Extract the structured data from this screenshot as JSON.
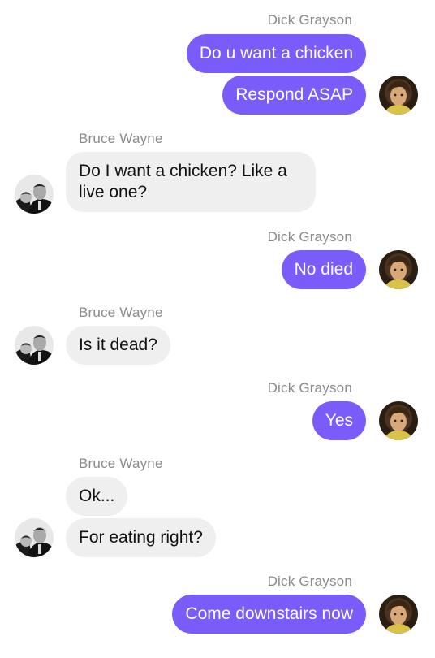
{
  "conversation": {
    "groups": [
      {
        "sender": "Dick Grayson",
        "messages": [
          "Do u want a chicken",
          "Respond ASAP"
        ]
      },
      {
        "sender": "Bruce Wayne",
        "messages": [
          "Do I want a chicken? Like a live one?"
        ]
      },
      {
        "sender": "Dick Grayson",
        "messages": [
          "No died"
        ]
      },
      {
        "sender": "Bruce Wayne",
        "messages": [
          "Is it dead?"
        ]
      },
      {
        "sender": "Dick Grayson",
        "messages": [
          "Yes"
        ]
      },
      {
        "sender": "Bruce Wayne",
        "messages": [
          "Ok...",
          "For eating right?"
        ]
      },
      {
        "sender": "Dick Grayson",
        "messages": [
          "Come downstairs now"
        ]
      }
    ]
  },
  "colors": {
    "outgoing_bubble": "#7a5cfa",
    "incoming_bubble": "#efeff0",
    "sender_label": "#8a8a8e"
  },
  "icons": {
    "dick_avatar": "dick-grayson-avatar",
    "bruce_avatar": "bruce-wayne-avatar"
  }
}
